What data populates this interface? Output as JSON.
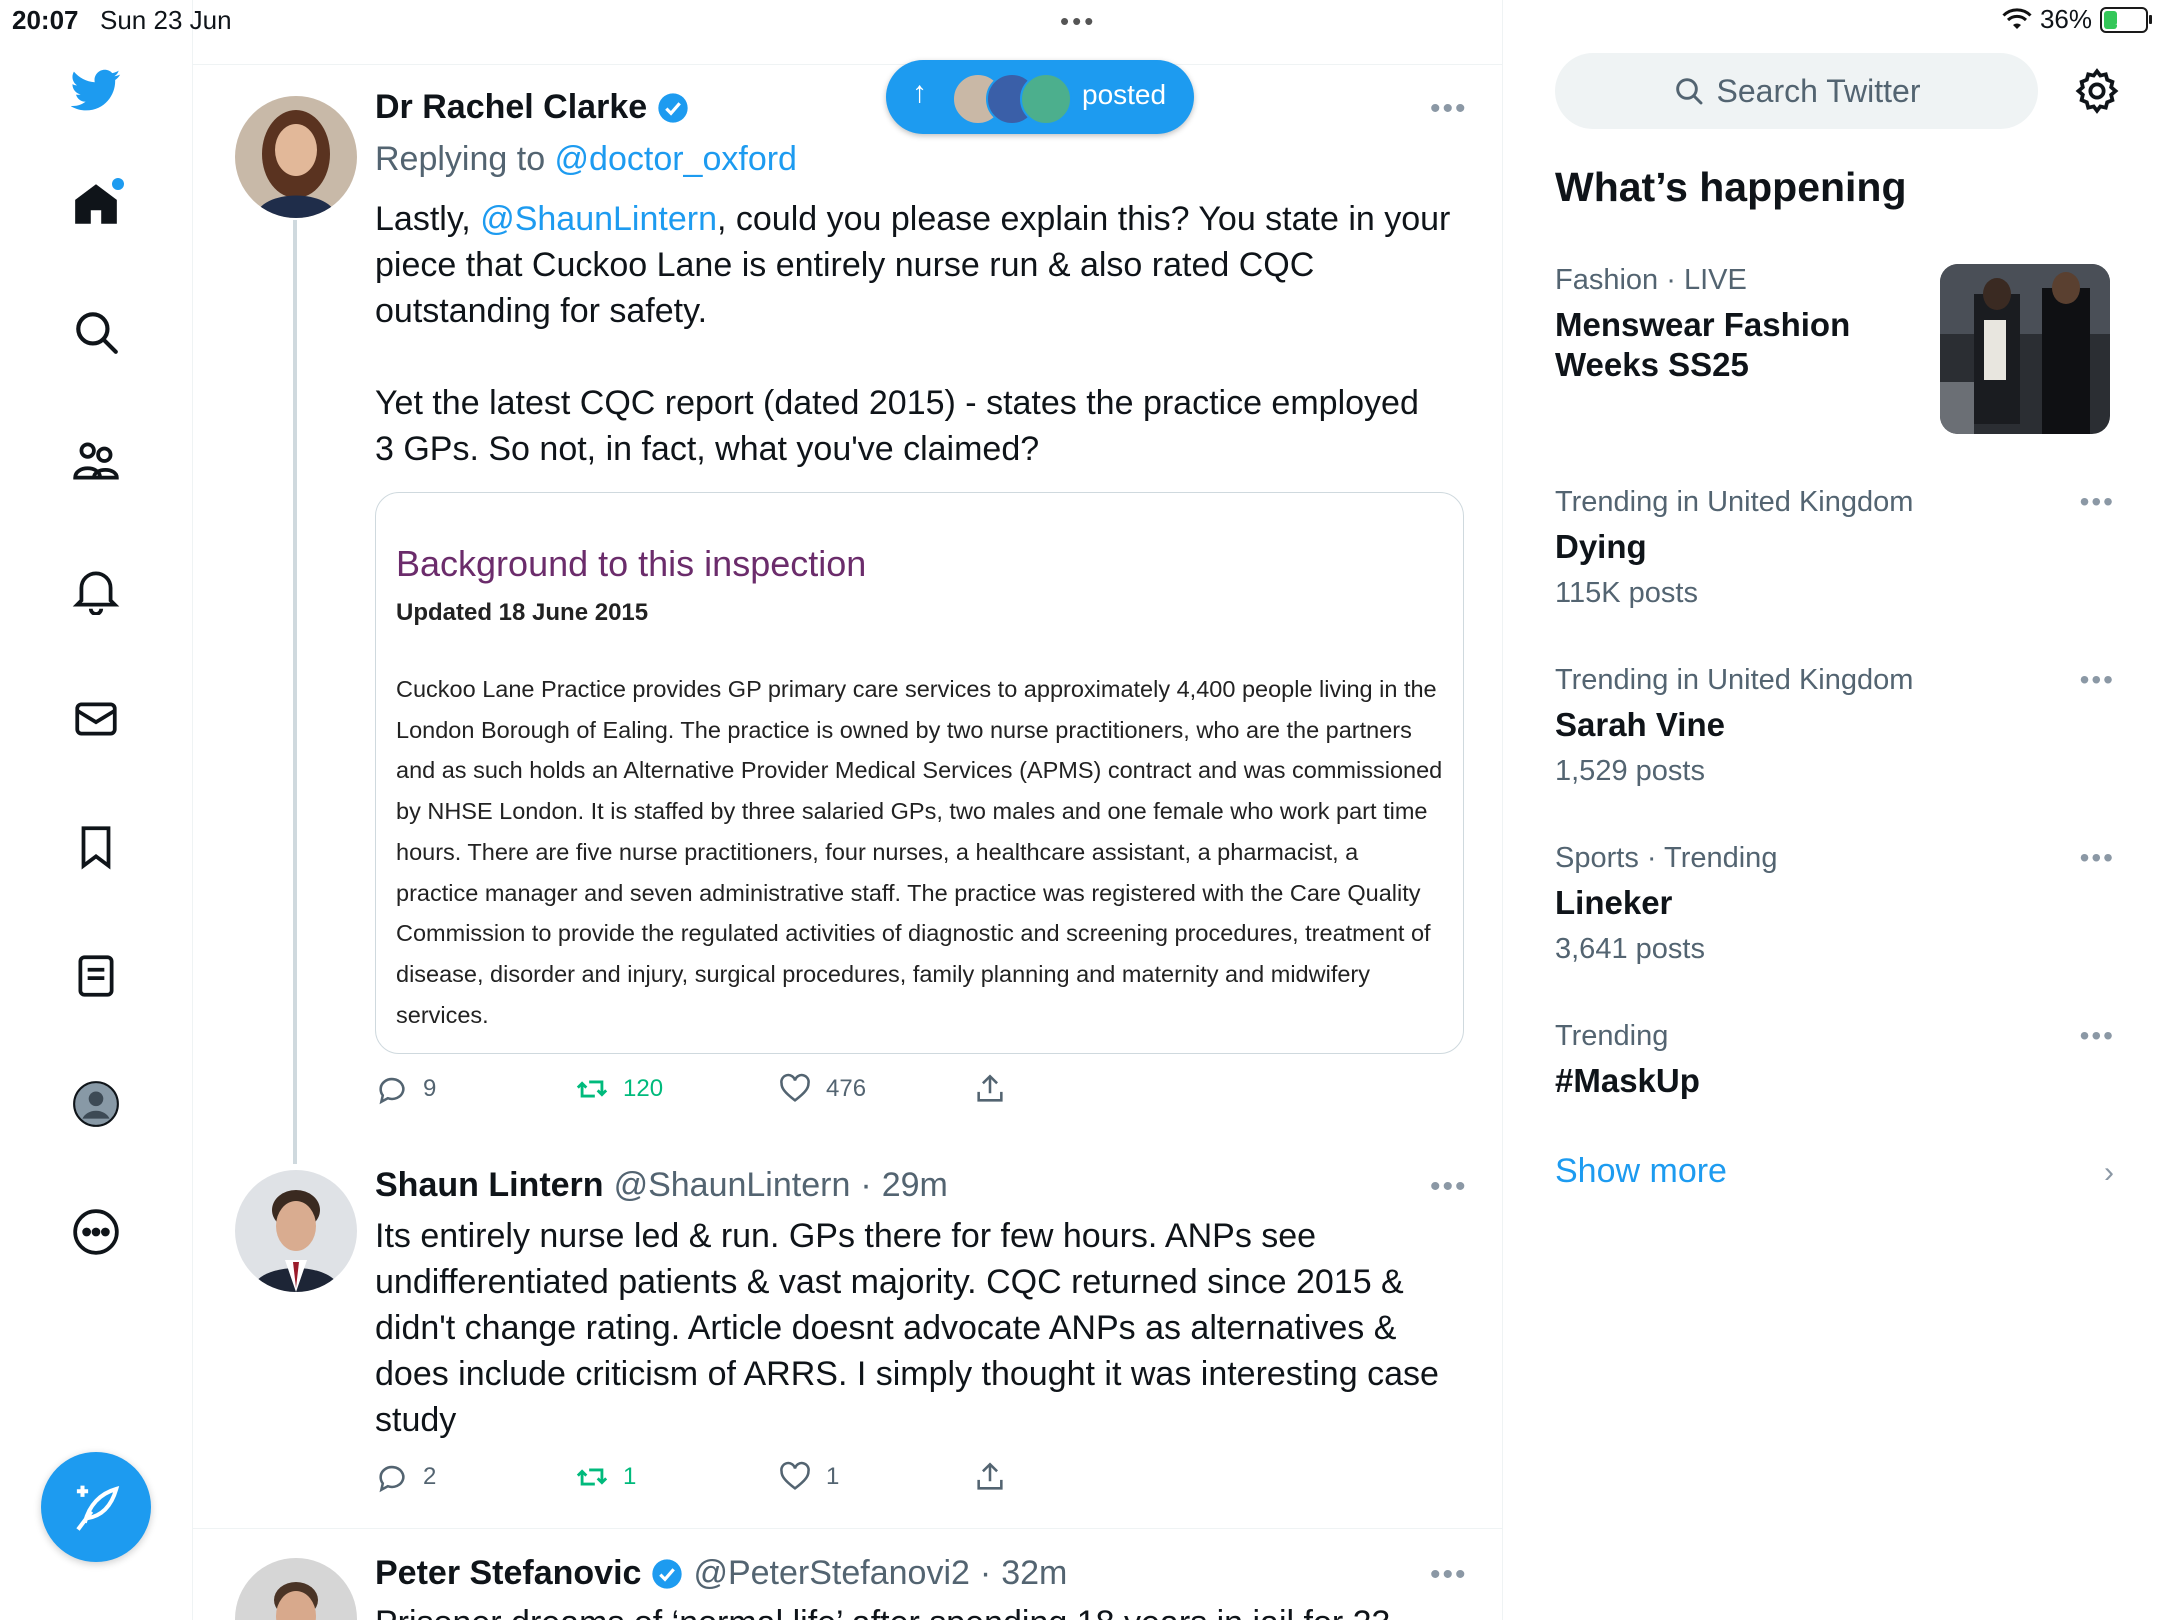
{
  "status_bar": {
    "time": "20:07",
    "date": "Sun 23 Jun",
    "battery": "36%",
    "battery_level": 0.36
  },
  "nav": {
    "items": [
      "home-icon",
      "search-icon",
      "communities-icon",
      "notifications-icon",
      "messages-icon",
      "bookmarks-icon",
      "lists-icon",
      "profile-icon",
      "more-icon"
    ],
    "compose_icon": "compose-feather-icon"
  },
  "posted_pill": {
    "label": "posted"
  },
  "tweets": [
    {
      "name": "Dr Rachel Clarke",
      "verified": true,
      "replying_prefix": "Replying to ",
      "replying_to": "@doctor_oxford",
      "text_pre": "Lastly, ",
      "text_mention": "@ShaunLintern",
      "text_post": ", could you please explain this? You state in your\npiece that Cuckoo Lane is entirely nurse run & also rated CQC\noutstanding for safety.\n\nYet the latest CQC report (dated 2015) - states the practice employed\n3 GPs. So not, in fact, what you've claimed?",
      "card": {
        "title": "Background to this inspection",
        "updated": "Updated 18 June 2015",
        "body": "Cuckoo Lane Practice provides GP primary care services to approximately 4,400 people living in the London Borough of Ealing. The practice is owned by two nurse practitioners, who are the partners and as such holds an Alternative Provider Medical Services (APMS) contract and was commissioned by NHSE London. It is staffed by three salaried GPs, two males and one female who work part time hours. There are five nurse practitioners, four nurses, a healthcare assistant, a pharmacist, a practice manager and seven administrative staff. The practice was registered with the Care Quality Commission to provide the regulated activities of diagnostic and screening procedures, treatment of disease, disorder and injury, surgical procedures, family planning and maternity and midwifery services."
      },
      "replies": "9",
      "retweets": "120",
      "likes": "476"
    },
    {
      "name": "Shaun Lintern",
      "handle": "@ShaunLintern",
      "time": "29m",
      "text": "Its entirely nurse led & run. GPs there for few hours. ANPs see\nundifferentiated patients & vast majority. CQC returned since 2015 &\ndidn't change rating. Article doesnt advocate ANPs as alternatives &\ndoes include criticism of ARRS. I simply thought it was interesting case\nstudy",
      "replies": "2",
      "retweets": "1",
      "likes": "1"
    },
    {
      "name": "Peter Stefanovic",
      "verified": true,
      "handle": "@PeterStefanovi2",
      "time": "32m",
      "text": "Prisoner dreams of ‘normal life’ after spending 18 years in jail for 23"
    }
  ],
  "right": {
    "search_placeholder": "Search Twitter",
    "whats_happening": "What’s happening",
    "featured": {
      "category": "Fashion",
      "status": "LIVE",
      "name": "Menswear Fashion Weeks SS25"
    },
    "trends": [
      {
        "category": "Trending in United Kingdom",
        "name": "Dying",
        "count": "115K posts"
      },
      {
        "category": "Trending in United Kingdom",
        "name": "Sarah Vine",
        "count": "1,529 posts"
      },
      {
        "category": "Sports · Trending",
        "name": "Lineker",
        "count": "3,641 posts"
      },
      {
        "category": "Trending",
        "name": "#MaskUp",
        "count": ""
      }
    ],
    "show_more": "Show more"
  }
}
